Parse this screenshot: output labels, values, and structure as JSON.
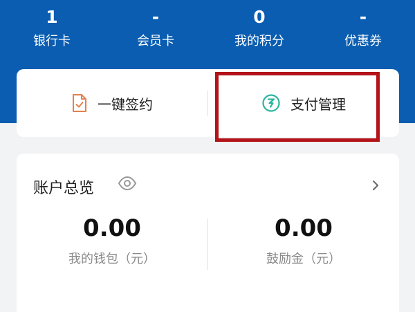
{
  "stats": [
    {
      "value": "1",
      "label": "银行卡"
    },
    {
      "value": "-",
      "label": "会员卡"
    },
    {
      "value": "0",
      "label": "我的积分"
    },
    {
      "value": "-",
      "label": "优惠券"
    }
  ],
  "actions": {
    "sign": {
      "label": "一键签约",
      "icon": "document-check-icon"
    },
    "pay": {
      "label": "支付管理",
      "icon": "payment-bolt-icon"
    }
  },
  "account": {
    "title": "账户总览",
    "balances": [
      {
        "value": "0.00",
        "label": "我的钱包（元）"
      },
      {
        "value": "0.00",
        "label": "鼓励金（元）"
      }
    ]
  },
  "colors": {
    "header_blue": "#0a5db1",
    "sign_icon": "#e0824f",
    "pay_icon": "#2ab69e",
    "highlight": "#b31419"
  }
}
